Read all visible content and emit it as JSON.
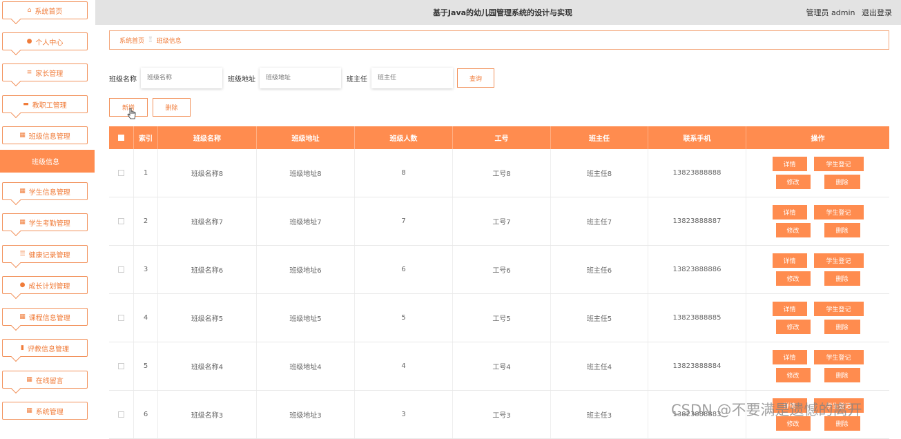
{
  "topbar": {
    "title": "基于Java的幼儿园管理系统的设计与实现",
    "admin_text": "管理员 admin",
    "logout": "退出登录"
  },
  "sidebar": {
    "items": [
      {
        "label": "系统首页",
        "icon": "home-icon"
      },
      {
        "label": "个人中心",
        "icon": "user-icon"
      },
      {
        "label": "家长管理",
        "icon": "list-icon"
      },
      {
        "label": "教职工管理",
        "icon": "briefcase-icon"
      },
      {
        "label": "班级信息管理",
        "icon": "grid-icon"
      },
      {
        "label": "学生信息管理",
        "icon": "grid-icon"
      },
      {
        "label": "学生考勤管理",
        "icon": "grid-icon"
      },
      {
        "label": "健康记录管理",
        "icon": "sliders-icon"
      },
      {
        "label": "成长计划管理",
        "icon": "user-icon"
      },
      {
        "label": "课程信息管理",
        "icon": "grid-icon"
      },
      {
        "label": "评教信息管理",
        "icon": "bar-chart-icon"
      },
      {
        "label": "在线留言",
        "icon": "grid-icon"
      },
      {
        "label": "系统管理",
        "icon": "grid-icon"
      }
    ],
    "active_sub": "班级信息"
  },
  "breadcrumb": {
    "home": "系统首页",
    "separator": "Ξ",
    "current": "班级信息"
  },
  "search": {
    "name_label": "班级名称",
    "name_placeholder": "班级名称",
    "addr_label": "班级地址",
    "addr_placeholder": "班级地址",
    "teacher_label": "班主任",
    "teacher_placeholder": "班主任",
    "query_button": "查询"
  },
  "actions": {
    "add": "新增",
    "delete": "删除"
  },
  "table": {
    "headers": [
      "索引",
      "班级名称",
      "班级地址",
      "班级人数",
      "工号",
      "班主任",
      "联系手机",
      "操作"
    ],
    "rows": [
      {
        "index": "1",
        "name": "班级名称8",
        "addr": "班级地址8",
        "count": "8",
        "no": "工号8",
        "teacher": "班主任8",
        "phone": "13823888888"
      },
      {
        "index": "2",
        "name": "班级名称7",
        "addr": "班级地址7",
        "count": "7",
        "no": "工号7",
        "teacher": "班主任7",
        "phone": "13823888887"
      },
      {
        "index": "3",
        "name": "班级名称6",
        "addr": "班级地址6",
        "count": "6",
        "no": "工号6",
        "teacher": "班主任6",
        "phone": "13823888886"
      },
      {
        "index": "4",
        "name": "班级名称5",
        "addr": "班级地址5",
        "count": "5",
        "no": "工号5",
        "teacher": "班主任5",
        "phone": "13823888885"
      },
      {
        "index": "5",
        "name": "班级名称4",
        "addr": "班级地址4",
        "count": "4",
        "no": "工号4",
        "teacher": "班主任4",
        "phone": "13823888884"
      },
      {
        "index": "6",
        "name": "班级名称3",
        "addr": "班级地址3",
        "count": "3",
        "no": "工号3",
        "teacher": "班主任3",
        "phone": "13823888883"
      }
    ],
    "ops": {
      "detail": "详情",
      "register": "学生登记",
      "edit": "修改",
      "delete": "删除"
    }
  },
  "watermark": "CSDN @不要满是遗憾的离开"
}
